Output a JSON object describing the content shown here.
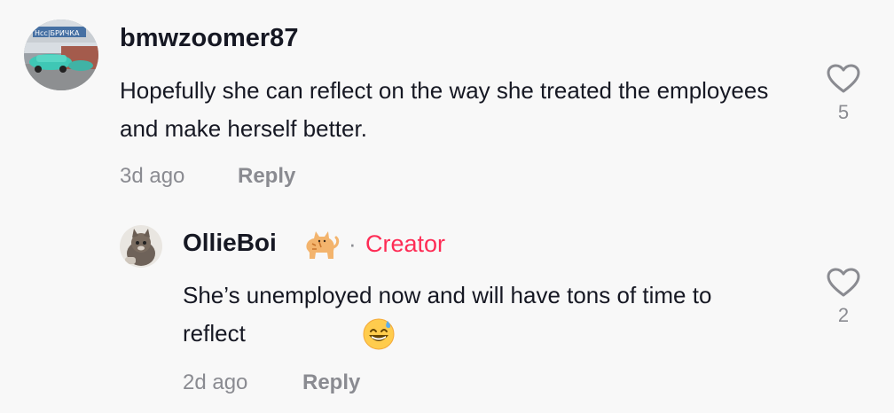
{
  "comments": [
    {
      "username": "bmwzoomer87",
      "avatar_icon": "car-photo-avatar",
      "avatar_text": "Нсс|БРИЧКА",
      "text": "Hopefully she can reflect on the way she treated the employees and make herself better.",
      "time": "3d ago",
      "reply_label": "Reply",
      "likes": "5",
      "like_icon": "heart-outline-icon"
    }
  ],
  "replies": [
    {
      "username": "OllieBoi",
      "name_emoji_icon": "cat-emoji-icon",
      "separator": "·",
      "badge": "Creator",
      "avatar_icon": "cat-photo-avatar",
      "text": "She’s unemployed now and will have tons of time to reflect",
      "text_emoji_icon": "grinning-sweat-emoji-icon",
      "time": "2d ago",
      "reply_label": "Reply",
      "likes": "2",
      "like_icon": "heart-outline-icon"
    }
  ],
  "colors": {
    "background": "#f8f8f8",
    "text": "#161823",
    "secondary": "#8a8b91",
    "creator": "#fe2c55"
  }
}
